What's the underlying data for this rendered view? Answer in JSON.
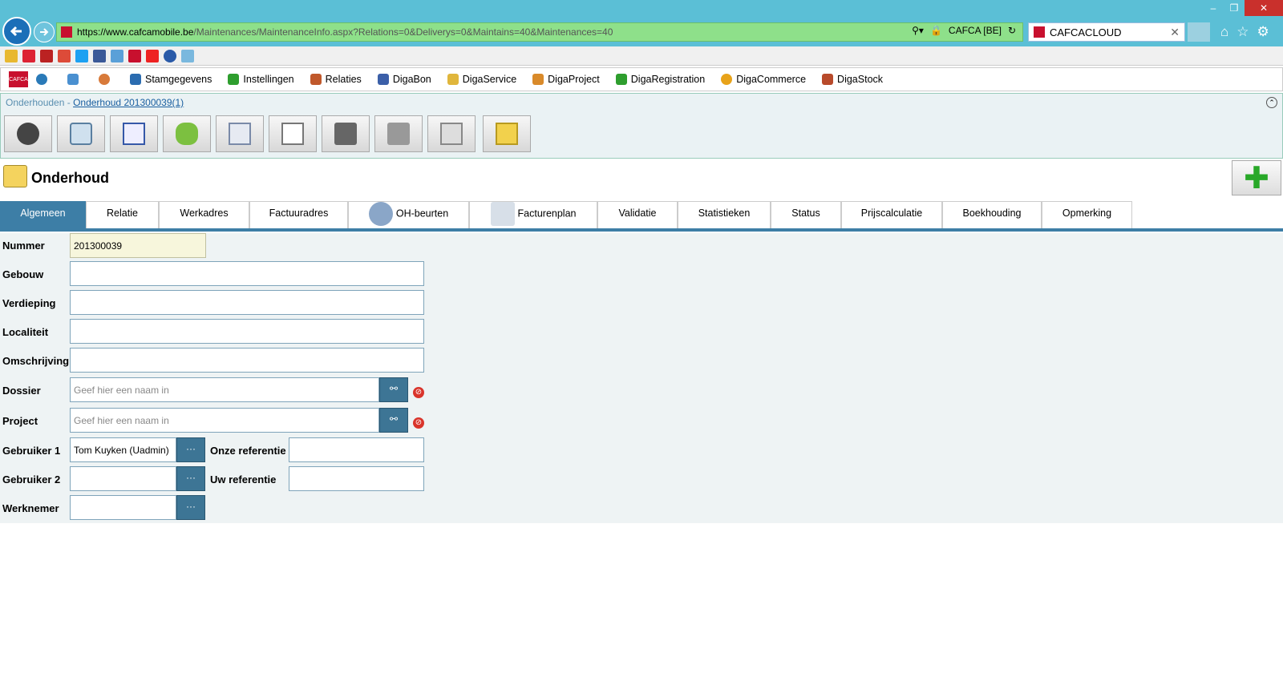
{
  "browser": {
    "url_host": "https://www.cafcamobile.be",
    "url_path": "/Maintenances/MaintenanceInfo.aspx?Relations=0&Deliverys=0&Maintains=40&Maintenances=40",
    "site_id": "CAFCA [BE]",
    "tab_title": "CAFCACLOUD"
  },
  "appmenu": {
    "logo": "CAFCA",
    "items": [
      "Stamgegevens",
      "Instellingen",
      "Relaties",
      "DigaBon",
      "DigaService",
      "DigaProject",
      "DigaRegistration",
      "DigaCommerce",
      "DigaStock"
    ],
    "icon_colors": [
      "#2b6cb0",
      "#2e9e2e",
      "#c0582b",
      "#3b5fa8",
      "#e0b63c",
      "#d98a2a",
      "#2e9e2e",
      "#e8a31a",
      "#b84a2b"
    ]
  },
  "breadcrumb": {
    "root": "Onderhouden - ",
    "current": "Onderhoud 201300039(1)"
  },
  "toolbar": {
    "buttons": [
      "alert-icon",
      "maintenance-icon",
      "checklist-icon",
      "plug-icon",
      "gear-doc-icon",
      "documents-icon",
      "book-icon",
      "print-icon",
      "folder-icon",
      "folder-clock-icon"
    ]
  },
  "page": {
    "title": "Onderhoud"
  },
  "tabs": [
    "Algemeen",
    "Relatie",
    "Werkadres",
    "Factuuradres",
    "OH-beurten",
    "Facturenplan",
    "Validatie",
    "Statistieken",
    "Status",
    "Prijscalculatie",
    "Boekhouding",
    "Opmerking"
  ],
  "form": {
    "nummer_label": "Nummer",
    "nummer_value": "201300039",
    "gebouw_label": "Gebouw",
    "verdieping_label": "Verdieping",
    "localiteit_label": "Localiteit",
    "omschrijving_label": "Omschrijving",
    "dossier_label": "Dossier",
    "dossier_placeholder": "Geef hier een naam in",
    "project_label": "Project",
    "project_placeholder": "Geef hier een naam in",
    "gebruiker1_label": "Gebruiker 1",
    "gebruiker1_value": "Tom Kuyken (Uadmin)",
    "gebruiker2_label": "Gebruiker 2",
    "werknemer_label": "Werknemer",
    "onze_ref_label": "Onze referentie",
    "uw_ref_label": "Uw referentie",
    "picker_label": "···"
  }
}
